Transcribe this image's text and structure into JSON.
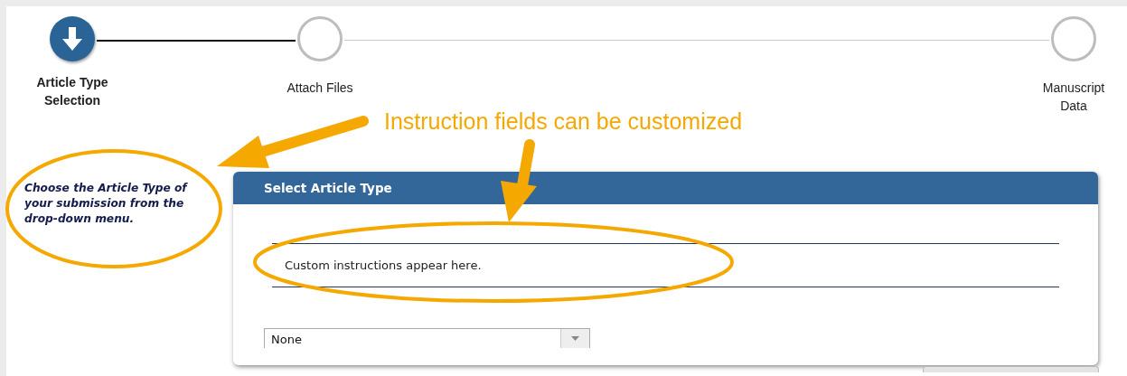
{
  "steps": [
    {
      "label": "Article Type Selection",
      "current": true
    },
    {
      "label": "Attach Files",
      "current": false
    },
    {
      "label": "Manuscript Data",
      "current": false
    }
  ],
  "side_instructions": "Choose the Article Type of your submission from the drop-down menu.",
  "panel": {
    "title": "Select Article Type",
    "instructions": "Custom instructions appear here.",
    "dropdown": {
      "value": "None"
    }
  },
  "annotation": {
    "text": "Instruction fields can be customized"
  }
}
